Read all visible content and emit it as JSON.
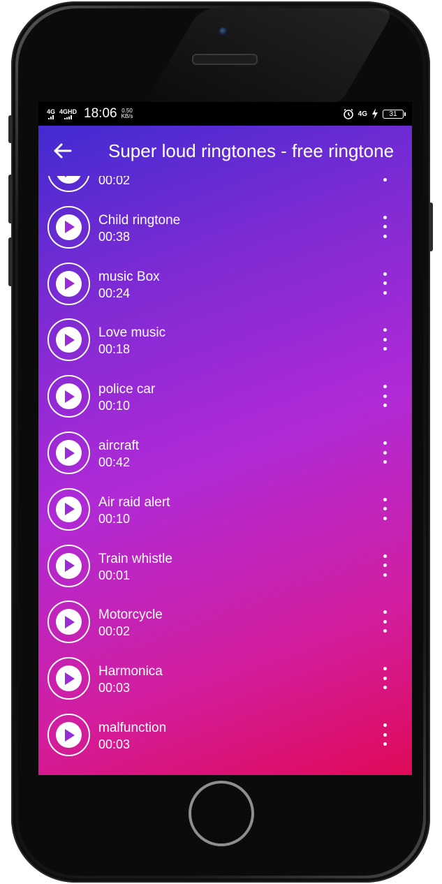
{
  "status_bar": {
    "network1": "4G",
    "network2": "4GHD",
    "time": "18:06",
    "speed_value": "0.50",
    "speed_unit": "KB/s",
    "right_network": "4G",
    "battery": "31",
    "icons": [
      "alarm-icon",
      "charging-icon",
      "battery-icon"
    ]
  },
  "app_bar": {
    "back_icon": "arrow-left-icon",
    "title": "Super loud ringtones - free ringtones"
  },
  "ringtones": [
    {
      "title": "",
      "duration": "00:02"
    },
    {
      "title": "Child ringtone",
      "duration": "00:38"
    },
    {
      "title": "music Box",
      "duration": "00:24"
    },
    {
      "title": "Love music",
      "duration": "00:18"
    },
    {
      "title": "police car",
      "duration": "00:10"
    },
    {
      "title": "aircraft",
      "duration": "00:42"
    },
    {
      "title": "Air raid alert",
      "duration": "00:10"
    },
    {
      "title": "Train whistle",
      "duration": "00:01"
    },
    {
      "title": "Motorcycle",
      "duration": "00:02"
    },
    {
      "title": "Harmonica",
      "duration": "00:03"
    },
    {
      "title": "malfunction",
      "duration": "00:03"
    }
  ],
  "colors": {
    "gradient_top": "#3a2bd0",
    "gradient_mid": "#b02ad6",
    "gradient_bottom": "#e00a58"
  }
}
